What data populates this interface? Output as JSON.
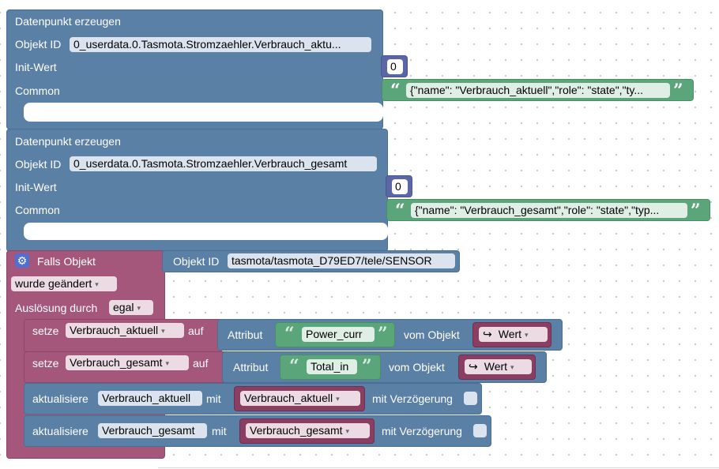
{
  "block1": {
    "title": "Datenpunkt erzeugen",
    "objekt_id_label": "Objekt ID",
    "objekt_id_value": "0_userdata.0.Tasmota.Stromzaehler.Verbrauch_aktu...",
    "init_label": "Init-Wert",
    "init_value": "0",
    "common_label": "Common",
    "common_value": "{\"name\": \"Verbrauch_aktuell\",\"role\": \"state\",\"ty..."
  },
  "block2": {
    "title": "Datenpunkt erzeugen",
    "objekt_id_label": "Objekt ID",
    "objekt_id_value": "0_userdata.0.Tasmota.Stromzaehler.Verbrauch_gesamt",
    "init_label": "Init-Wert",
    "init_value": "0",
    "common_label": "Common",
    "common_value": "{\"name\": \"Verbrauch_gesamt\",\"role\": \"state\",\"typ..."
  },
  "trigger": {
    "title": "Falls Objekt",
    "objekt_id_label": "Objekt ID",
    "objekt_id_value": "tasmota/tasmota_D79ED7/tele/SENSOR",
    "condition": "wurde geändert",
    "ausloesung_label": "Auslösung durch",
    "ausloesung_value": "egal"
  },
  "set1": {
    "setze": "setze",
    "variable": "Verbrauch_aktuell",
    "auf": "auf",
    "attribut": "Attribut",
    "attribut_value": "Power_curr",
    "vom_objekt": "vom Objekt",
    "wert": "Wert"
  },
  "set2": {
    "setze": "setze",
    "variable": "Verbrauch_gesamt",
    "auf": "auf",
    "attribut": "Attribut",
    "attribut_value": "Total_in",
    "vom_objekt": "vom Objekt",
    "wert": "Wert"
  },
  "update1": {
    "label": "aktualisiere",
    "target": "Verbrauch_aktuell",
    "mit": "mit",
    "value": "Verbrauch_aktuell",
    "delay_label": "mit Verzögerung"
  },
  "update2": {
    "label": "aktualisiere",
    "target": "Verbrauch_gesamt",
    "mit": "mit",
    "value": "Verbrauch_gesamt",
    "delay_label": "mit Verzögerung"
  },
  "icons": {
    "quote_open": "“",
    "quote_close": "”",
    "dropdown": "▾",
    "gear": "⚙",
    "arrow": "↪"
  },
  "colors": {
    "action_blue": "#5b80a5",
    "trigger_pink": "#a5577b",
    "text_green": "#5ba57b",
    "number_purple": "#5b67a5"
  }
}
